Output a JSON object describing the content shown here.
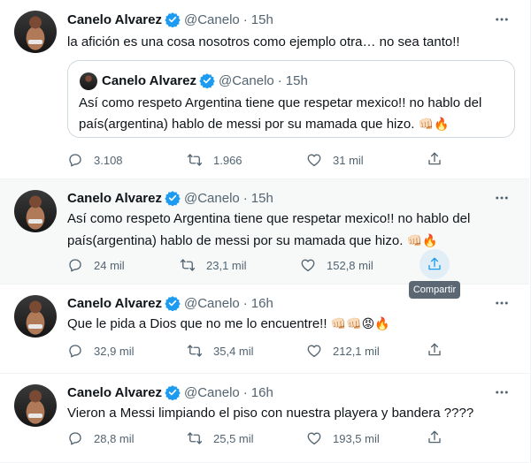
{
  "colors": {
    "accent": "#1d9bf0",
    "text": "#0f1419",
    "muted": "#536471",
    "highlight_bg": "#f7f9f9"
  },
  "tweets": [
    {
      "name": "Canelo Alvarez",
      "handle": "@Canelo",
      "dot": "·",
      "time": "15h",
      "text": "la afición es una cosa nosotros como ejemplo otra… no sea tanto!!",
      "quote": {
        "name": "Canelo Alvarez",
        "handle": "@Canelo",
        "dot": "·",
        "time": "15h",
        "text": "Así como respeto Argentina tiene que respetar mexico!! no hablo del país(argentina) hablo de messi por su mamada que hizo.",
        "emoji": "👊🏻🔥"
      },
      "replies": "3.108",
      "retweets": "1.966",
      "likes": "31 mil"
    },
    {
      "name": "Canelo Alvarez",
      "handle": "@Canelo",
      "dot": "·",
      "time": "15h",
      "text": "Así como respeto Argentina tiene que respetar mexico!! no hablo del país(argentina) hablo de messi por su mamada que hizo.",
      "emoji": "👊🏻🔥",
      "replies": "24 mil",
      "retweets": "23,1 mil",
      "likes": "152,8 mil",
      "share_tooltip": "Compartir"
    },
    {
      "name": "Canelo Alvarez",
      "handle": "@Canelo",
      "dot": "·",
      "time": "16h",
      "text": "Que le pida a Dios que no me lo encuentre!!",
      "emoji": "👊🏻👊🏻😡🔥",
      "replies": "32,9 mil",
      "retweets": "35,4 mil",
      "likes": "212,1 mil"
    },
    {
      "name": "Canelo Alvarez",
      "handle": "@Canelo",
      "dot": "·",
      "time": "16h",
      "text": "Vieron a Messi limpiando el piso con nuestra playera y bandera ????",
      "replies": "28,8 mil",
      "retweets": "25,5 mil",
      "likes": "193,5 mil"
    }
  ],
  "icons": {
    "verified": "verified-badge-icon",
    "more": "more-options-icon",
    "reply": "reply-icon",
    "retweet": "retweet-icon",
    "like": "like-icon",
    "share": "share-icon"
  }
}
